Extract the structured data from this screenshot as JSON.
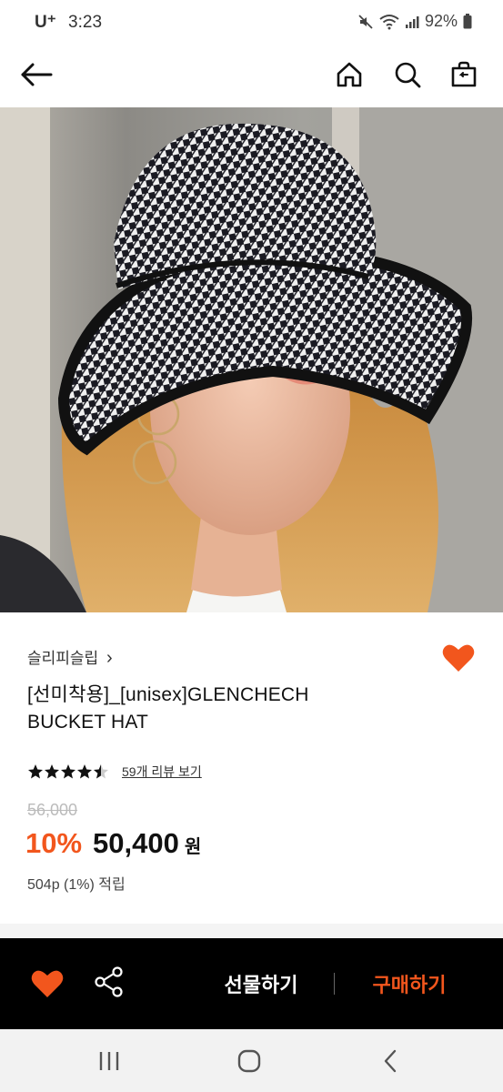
{
  "status_bar": {
    "carrier": "U⁺",
    "time": "3:23",
    "battery": "92%"
  },
  "header": {
    "back_icon": "arrow-left-icon",
    "home_icon": "home-icon",
    "search_icon": "search-icon",
    "bag_icon": "shopping-bag-icon"
  },
  "product": {
    "brand": "슬리피슬립",
    "brand_chevron": "›",
    "title_line1": "[선미착용]_[unisex]GLENCHECH",
    "title_line2": "BUCKET HAT",
    "rating": 4.5,
    "review_link": "59개 리뷰 보기",
    "original_price": "56,000",
    "discount": "10%",
    "price": "50,400",
    "currency": "원",
    "points": "504p (1%) 적립"
  },
  "bottom_bar": {
    "gift_label": "선물하기",
    "buy_label": "구매하기"
  },
  "colors": {
    "accent": "#f2561d",
    "bottom_bar_bg": "#000000"
  }
}
